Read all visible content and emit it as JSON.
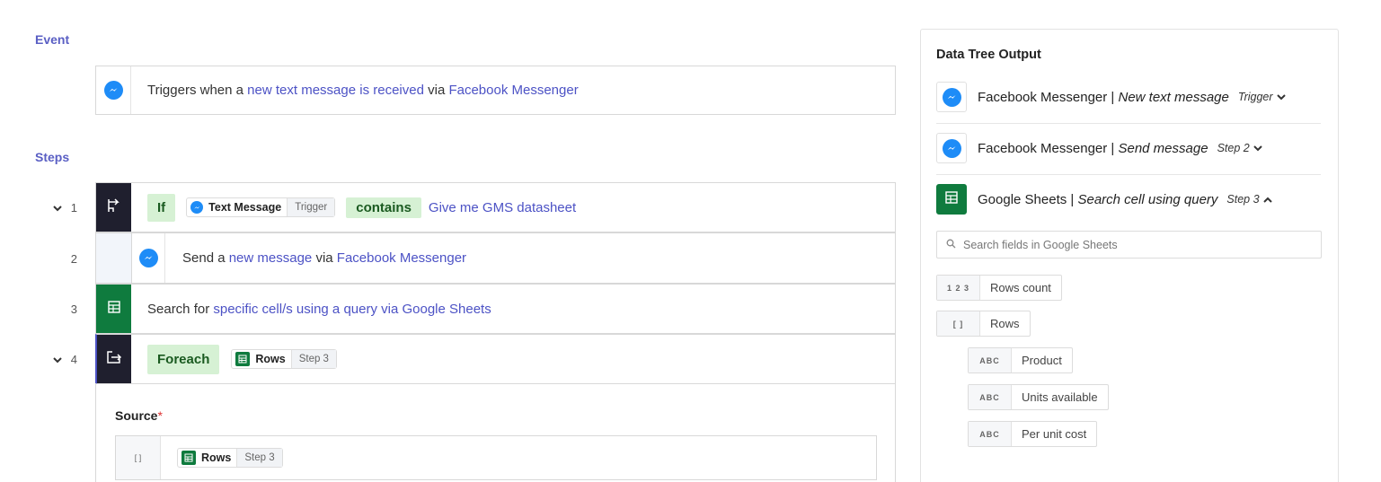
{
  "event": {
    "section_title": "Event",
    "prefix": "Triggers when a ",
    "trigger_link": "new text message is received",
    "via": " via ",
    "app_link": "Facebook Messenger"
  },
  "steps": {
    "section_title": "Steps",
    "step1": {
      "number": "1",
      "keyword": "If",
      "chip_label": "Text Message",
      "chip_tag": "Trigger",
      "operator": "contains",
      "value": "Give me GMS datasheet"
    },
    "step2": {
      "number": "2",
      "prefix": "Send a ",
      "action_link": "new message",
      "via": " via ",
      "app_link": "Facebook Messenger"
    },
    "step3": {
      "number": "3",
      "prefix": "Search for ",
      "action_link": "specific cell/s using a query via Google Sheets"
    },
    "step4": {
      "number": "4",
      "keyword": "Foreach",
      "chip_label": "Rows",
      "chip_tag": "Step 3",
      "source_label": "Source",
      "source_required": "*",
      "source_type": "[ ]",
      "source_chip_label": "Rows",
      "source_chip_tag": "Step 3"
    }
  },
  "tree": {
    "title": "Data Tree Output",
    "items": [
      {
        "app": "Facebook Messenger",
        "sep": " | ",
        "action": "New text message",
        "tag": "Trigger"
      },
      {
        "app": "Facebook Messenger",
        "sep": " | ",
        "action": "Send message",
        "tag": "Step 2"
      },
      {
        "app": "Google Sheets",
        "sep": " | ",
        "action": "Search cell using query",
        "tag": "Step 3"
      }
    ],
    "search_placeholder": "Search fields in Google Sheets",
    "fields": [
      {
        "type": "1 2 3",
        "label": "Rows count"
      },
      {
        "type": "[ ]",
        "label": "Rows"
      },
      {
        "type": "ABC",
        "label": "Product"
      },
      {
        "type": "ABC",
        "label": "Units available"
      },
      {
        "type": "ABC",
        "label": "Per unit cost"
      }
    ]
  },
  "colors": {
    "accent": "#4c52c5",
    "messenger_blue": "#1e8cf7",
    "sheets_green": "#0f7b3e",
    "pill_green_bg": "#d6f1d4",
    "dark_icon_bg": "#1f1f2e"
  },
  "icons": {
    "messenger": "messenger-icon",
    "sheets": "google-sheets-icon",
    "condition": "branch-icon",
    "loop": "loop-icon",
    "chevron_down": "chevron-down-icon",
    "chevron_up": "chevron-up-icon",
    "search": "search-icon"
  }
}
